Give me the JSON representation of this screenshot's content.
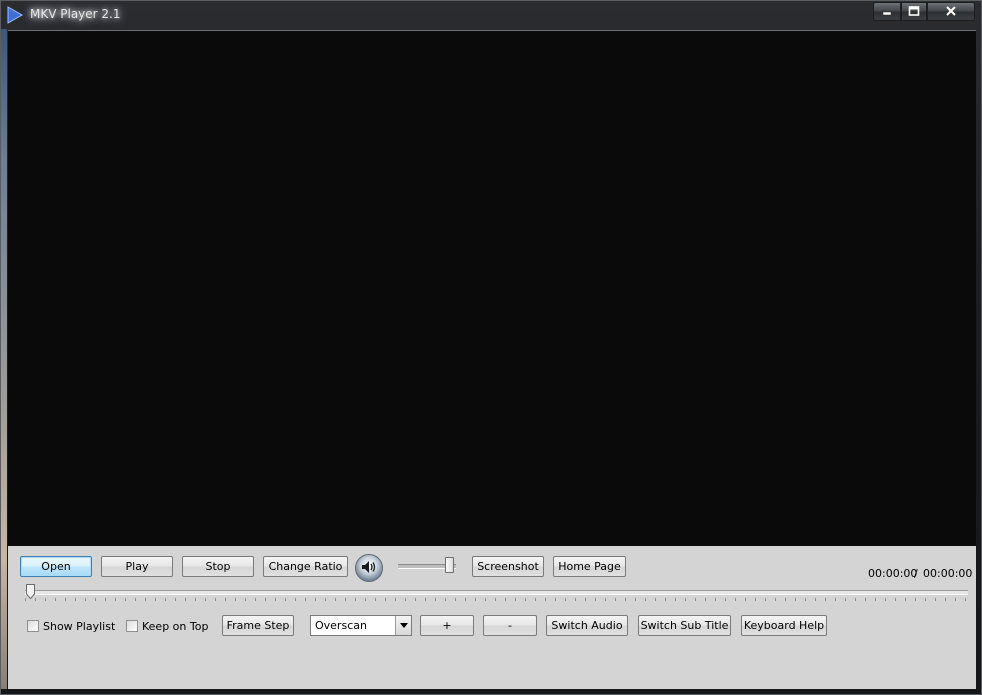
{
  "window": {
    "title": "MKV Player 2.1",
    "caption": {
      "minimize": "minimize",
      "maximize": "maximize",
      "close": "close"
    }
  },
  "controls": {
    "open_label": "Open",
    "play_label": "Play",
    "stop_label": "Stop",
    "change_ratio_label": "Change Ratio",
    "screenshot_label": "Screenshot",
    "home_page_label": "Home Page",
    "frame_step_label": "Frame Step",
    "plus_label": "+",
    "minus_label": "-",
    "switch_audio_label": "Switch Audio",
    "switch_subtitle_label": "Switch Sub Title",
    "keyboard_help_label": "Keyboard Help"
  },
  "time": {
    "current": "00:00:00",
    "separator": "/",
    "total": "00:00:00"
  },
  "options": {
    "show_playlist": {
      "label": "Show Playlist",
      "checked": false
    },
    "keep_on_top": {
      "label": "Keep on Top",
      "checked": false
    }
  },
  "zoom_mode": {
    "selected": "Overscan"
  },
  "seek": {
    "progress": 0
  },
  "volume": {
    "level": 0.9
  },
  "icons": {
    "app": "play-triangle-icon",
    "volume": "speaker-icon",
    "dropdown": "chevron-down-icon"
  },
  "colors": {
    "video_background": "#0a0a0a",
    "panel_background": "#d4d4d4",
    "focused_button_border": "#3c7fb1"
  }
}
